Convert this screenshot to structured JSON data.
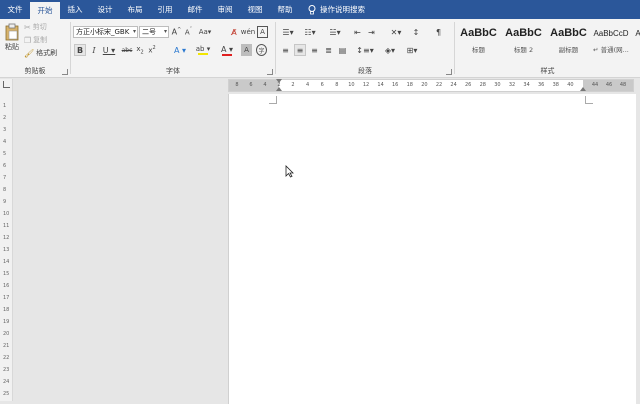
{
  "tabs": [
    "文件",
    "开始",
    "插入",
    "设计",
    "布局",
    "引用",
    "邮件",
    "审阅",
    "视图",
    "帮助"
  ],
  "active_tab": "开始",
  "tell_me": "操作说明搜索",
  "clipboard": {
    "paste_label": "粘贴",
    "cut_label": "剪切",
    "copy_label": "复制",
    "format_painter_label": "格式刷",
    "group_label": "剪贴板"
  },
  "font": {
    "font_name": "方正小标宋_GBK",
    "font_size": "二号",
    "group_label": "字体"
  },
  "paragraph": {
    "group_label": "段落"
  },
  "styles": {
    "items": [
      {
        "sample": "AaBbC",
        "name": "标题"
      },
      {
        "sample": "AaBbC",
        "name": "标题 2"
      },
      {
        "sample": "AaBbC",
        "name": "副标题"
      },
      {
        "sample": "AaBbCcD",
        "name": "↵ 普通(网..."
      },
      {
        "sample": "A",
        "name": ""
      }
    ],
    "group_label": "样式"
  },
  "hruler": {
    "left_labels": [
      "8",
      "6",
      "4",
      "2"
    ],
    "labels": [
      "2",
      "4",
      "6",
      "8",
      "10",
      "12",
      "14",
      "16",
      "18",
      "20",
      "22",
      "24",
      "26",
      "28",
      "30",
      "32",
      "34",
      "36",
      "38",
      "40"
    ],
    "right_labels": [
      "44",
      "46",
      "48"
    ]
  },
  "vruler": {
    "labels": [
      "1",
      "2",
      "3",
      "4",
      "5",
      "6",
      "7",
      "8",
      "9",
      "10",
      "11",
      "12",
      "13",
      "14",
      "15",
      "16",
      "17",
      "18",
      "19",
      "20",
      "21",
      "22",
      "23",
      "24",
      "25"
    ]
  },
  "colors": {
    "title_bar": "#2b579a",
    "ribbon": "#f3f3f3",
    "workspace": "#e6e6e6",
    "font_color_underline": "#e02020",
    "highlight_underline": "#f2e600"
  }
}
